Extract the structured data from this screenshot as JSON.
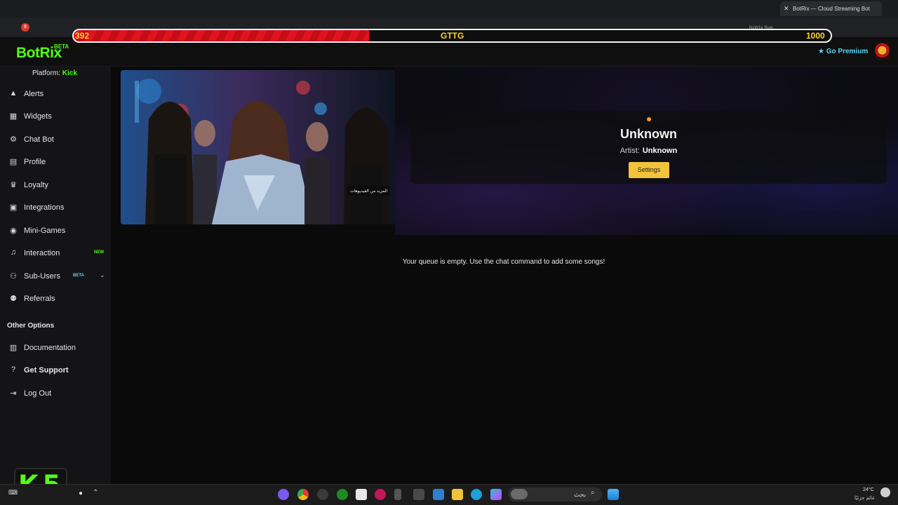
{
  "browser": {
    "tab_title": "BotRix — Cloud Streaming Bot",
    "url": "botrix.live"
  },
  "overlay": {
    "hp_current": "392",
    "hp_label": "GTTG",
    "hp_max": "1000",
    "hp_fill_fraction": 0.39
  },
  "header": {
    "logo": "BotRix",
    "beta": "BETA",
    "premium": "Go Premium"
  },
  "sidebar": {
    "platform_label": "Platform:",
    "platform_value": "Kick",
    "items": [
      {
        "label": "Alerts",
        "icon": "warning-icon"
      },
      {
        "label": "Widgets",
        "icon": "grid-icon"
      },
      {
        "label": "Chat Bot",
        "icon": "robot-icon"
      },
      {
        "label": "Profile",
        "icon": "id-card-icon"
      },
      {
        "label": "Loyalty",
        "icon": "trophy-icon"
      },
      {
        "label": "Integrations",
        "icon": "integration-icon"
      },
      {
        "label": "Mini-Games",
        "icon": "gamepad-icon"
      },
      {
        "label": "Interaction",
        "icon": "music-icon",
        "tag": "NEW"
      },
      {
        "label": "Sub-Users",
        "icon": "users-icon",
        "tag": "BETA"
      },
      {
        "label": "Referrals",
        "icon": "user-group-icon"
      }
    ],
    "other_heading": "Other Options",
    "other_items": [
      {
        "label": "Documentation",
        "icon": "book-icon"
      },
      {
        "label": "Get Support",
        "icon": "question-icon"
      },
      {
        "label": "Log Out",
        "icon": "logout-icon"
      }
    ]
  },
  "player": {
    "video_caption": "المزيد من الفيديوهات",
    "title": "Unknown",
    "artist_label": "Artist:",
    "artist_value": "Unknown",
    "settings_label": "Settings",
    "queue_message": "Your queue is empty. Use the chat command to add some songs!"
  },
  "badge": {
    "text": "K5"
  },
  "taskbar": {
    "search_text": "بحث",
    "temperature": "24°C",
    "weather": "غائم جزئيًا"
  },
  "colors": {
    "kick_green": "#53fc18",
    "settings_yellow": "#f3c33a",
    "hp_red": "#e2121f",
    "premium_cyan": "#5ad8f0"
  }
}
